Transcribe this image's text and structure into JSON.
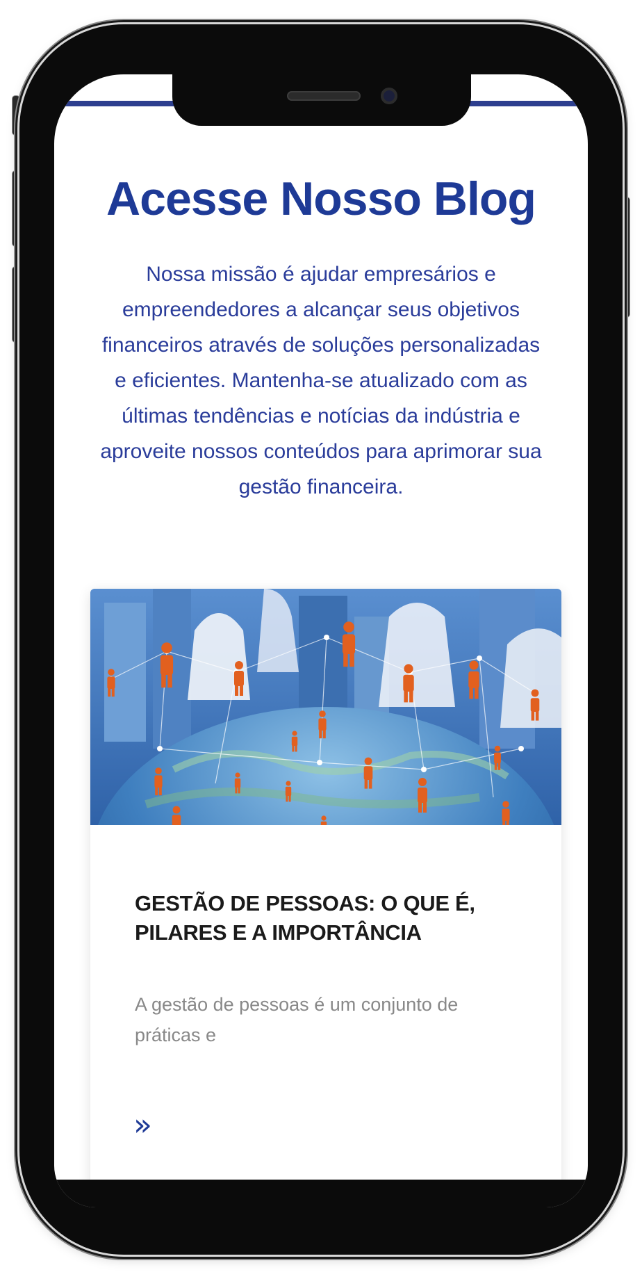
{
  "blog": {
    "title": "Acesse Nosso Blog",
    "intro": "Nossa missão é ajudar empresários e empreendedores a alcançar seus objetivos financeiros através de soluções personalizadas e eficientes. Mantenha-se atualizado com as últimas tendências e notícias da indústria e aproveite nossos conteúdos para aprimorar sua gestão financeira."
  },
  "post": {
    "image_icon": "people-network-globe-image",
    "title": "GESTÃO DE PESSOAS: O QUE É, PILARES E A IMPORTÂNCIA",
    "excerpt": "A gestão de pessoas é um conjunto de práticas e",
    "read_more_icon": "double-chevron-right-icon",
    "read_more_glyph": "»"
  },
  "colors": {
    "accent": "#1e3a96",
    "title_text": "#1a1a1a",
    "excerpt_text": "#888888",
    "figure": "#e2601f"
  }
}
